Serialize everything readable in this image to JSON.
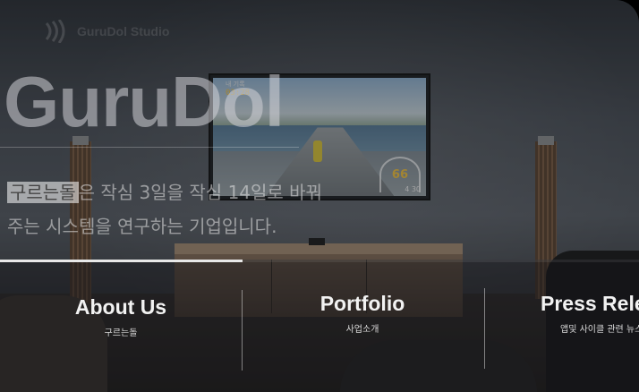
{
  "header": {
    "logo_text": "GuruDol Studio",
    "logo_icon": "sound-wave-icon"
  },
  "hero": {
    "title": "GuruDol",
    "tagline_highlight": "구르는돌",
    "tagline_rest_line1": "은 작심 3일을 작심 14일로 바꿔",
    "tagline_line2": "주는 시스템을 연구하는 기업입니다."
  },
  "tv": {
    "label": "내 기록",
    "time": "03:28",
    "speed": "66",
    "sub": "4  30"
  },
  "slider": {
    "progress": 0.38
  },
  "nav": {
    "items": [
      {
        "title": "About Us",
        "subtitle": "구르는돌"
      },
      {
        "title": "Portfolio",
        "subtitle": "사업소개"
      },
      {
        "title": "Press Release",
        "subtitle": "앱및 사이클 관련 뉴스"
      }
    ]
  },
  "colors": {
    "accent": "#e8e8e8",
    "nav_text": "#f2f2f2"
  }
}
